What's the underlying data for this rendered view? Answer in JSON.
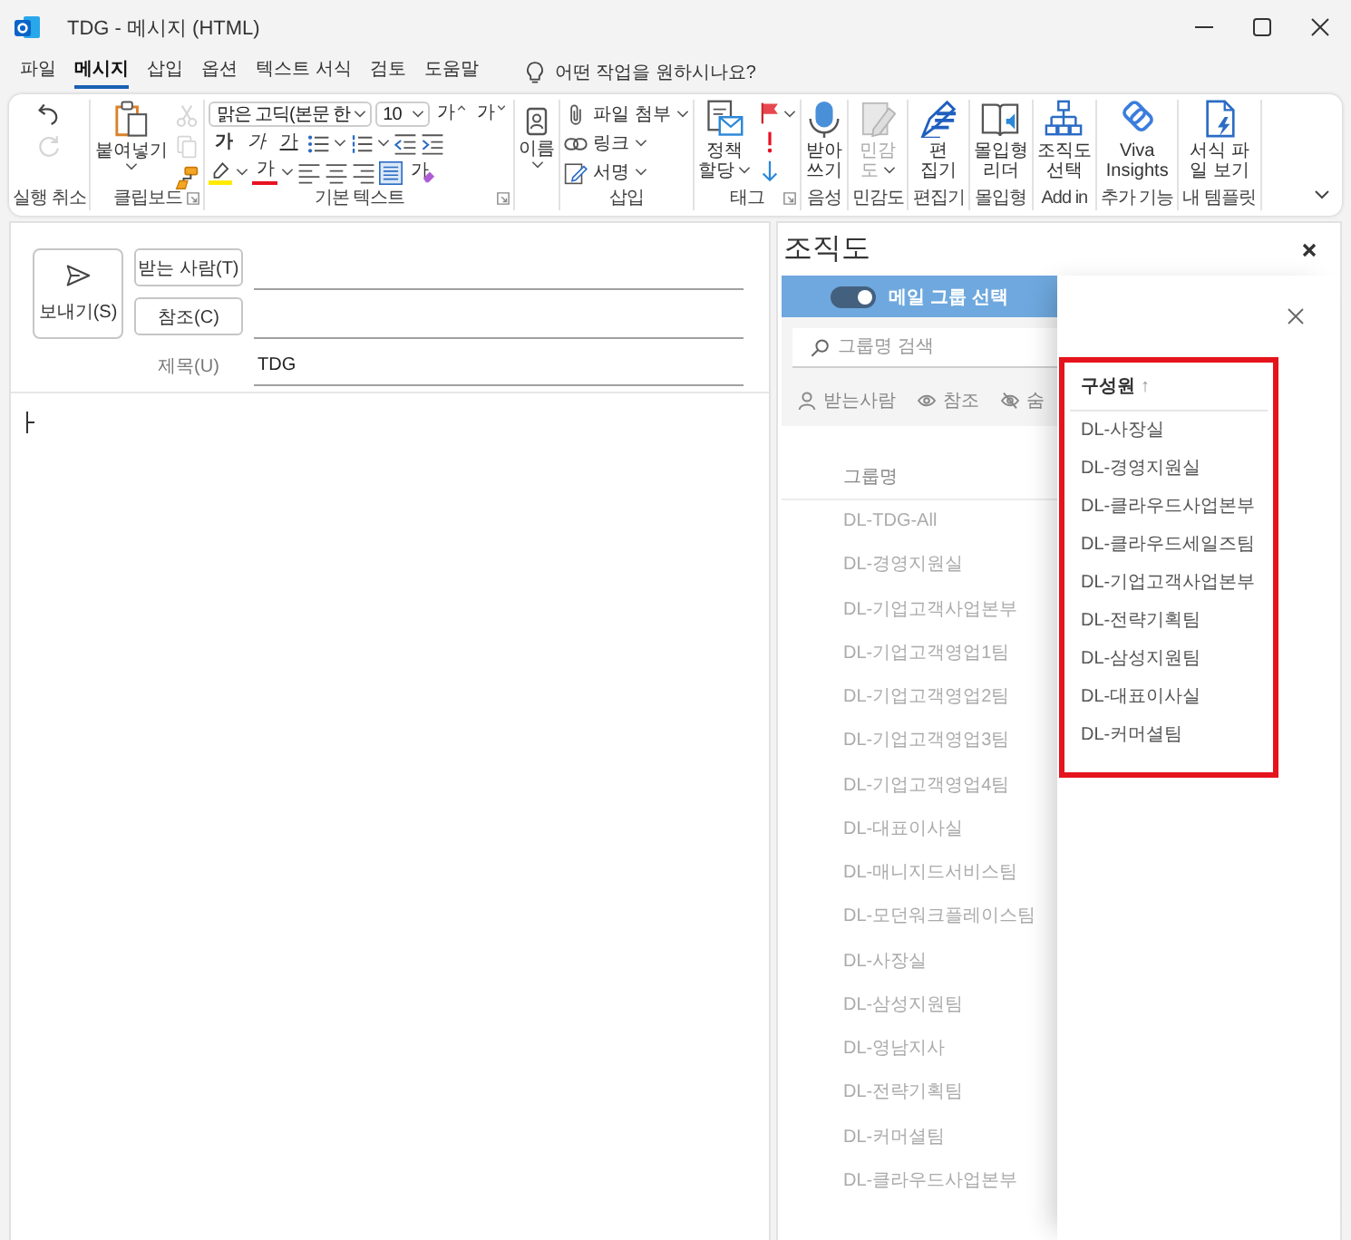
{
  "window": {
    "title": "TDG - 메시지 (HTML)"
  },
  "menu_tabs": [
    {
      "label": "파일",
      "selected": false
    },
    {
      "label": "메시지",
      "selected": true
    },
    {
      "label": "삽입",
      "selected": false
    },
    {
      "label": "옵션",
      "selected": false
    },
    {
      "label": "텍스트 서식",
      "selected": false
    },
    {
      "label": "검토",
      "selected": false
    },
    {
      "label": "도움말",
      "selected": false
    }
  ],
  "tell_me": {
    "placeholder": "어떤 작업을 원하시나요?"
  },
  "ribbon": {
    "groups": [
      {
        "kind": "undo",
        "label": "실행 취소",
        "buttons": [
          {
            "kind": "undo",
            "disabled": false
          },
          {
            "kind": "redo",
            "disabled": true
          }
        ]
      },
      {
        "kind": "clipboard",
        "label": "클립보드",
        "launcher": true,
        "paste": "붙여넣기",
        "buttons": [
          {
            "kind": "cut",
            "disabled": true
          },
          {
            "kind": "copy",
            "disabled": true
          },
          {
            "kind": "format-painter",
            "disabled": false
          }
        ]
      },
      {
        "kind": "basic-text",
        "label": "기본 텍스트",
        "launcher": true,
        "font": "맑은 고딕(본문 한",
        "size": "10",
        "grow": "가",
        "shrink": "가",
        "styles": [
          {
            "kind": "bold",
            "text": "가"
          },
          {
            "kind": "italic",
            "text": "가"
          },
          {
            "kind": "underline",
            "text": "가"
          }
        ],
        "font_color": "가",
        "clear_format": "가"
      },
      {
        "kind": "names",
        "button": "이름"
      },
      {
        "kind": "include",
        "label": "삽입",
        "items": [
          {
            "kind": "attach",
            "text": "파일 첨부"
          },
          {
            "kind": "link",
            "text": "링크"
          },
          {
            "kind": "signature",
            "text": "서명"
          }
        ]
      },
      {
        "kind": "tags",
        "label": "태그",
        "launcher": true,
        "policy": "정책\n할당"
      },
      {
        "kind": "big",
        "label": "음성",
        "button": {
          "kind": "dictate",
          "text": "받아\n쓰기",
          "disabled": false
        }
      },
      {
        "kind": "big",
        "label": "민감도",
        "button": {
          "kind": "sensitivity",
          "text": "민감\n도",
          "caret": true,
          "disabled": true
        }
      },
      {
        "kind": "big",
        "label": "편집기",
        "button": {
          "kind": "editor",
          "text": "편\n집기",
          "disabled": false
        }
      },
      {
        "kind": "big",
        "label": "몰입형",
        "button": {
          "kind": "reader",
          "text": "몰입형\n리더",
          "disabled": false
        }
      },
      {
        "kind": "big",
        "label": "Add in",
        "button": {
          "kind": "org-chart",
          "text": "조직도\n선택",
          "disabled": false
        }
      },
      {
        "kind": "big",
        "label": "추가 기능",
        "button": {
          "kind": "viva",
          "text": "Viva\nInsights",
          "disabled": false
        }
      },
      {
        "kind": "big",
        "label": "내 템플릿",
        "button": {
          "kind": "template",
          "text": "서식 파\n일 보기",
          "disabled": false
        }
      }
    ]
  },
  "compose": {
    "send": "보내기(S)",
    "to_button": "받는 사람(T)",
    "cc_button": "참조(C)",
    "subject_label": "제목(U)",
    "subject": "TDG"
  },
  "org_pane": {
    "title": "조직도",
    "group_mode": {
      "label": "메일 그룹 선택",
      "on": true
    },
    "search": {
      "placeholder": "그룹명 검색"
    },
    "recipient_types": [
      {
        "kind": "to",
        "label": "받는사람"
      },
      {
        "kind": "cc",
        "label": "참조"
      },
      {
        "kind": "bcc",
        "label": "숨"
      }
    ],
    "groups": {
      "header": "그룹명",
      "items": [
        "DL-TDG-All",
        "DL-경영지원실",
        "DL-기업고객사업본부",
        "DL-기업고객영업1팀",
        "DL-기업고객영업2팀",
        "DL-기업고객영업3팀",
        "DL-기업고객영업4팀",
        "DL-대표이사실",
        "DL-매니지드서비스팀",
        "DL-모던워크플레이스팀",
        "DL-사장실",
        "DL-삼성지원팀",
        "DL-영남지사",
        "DL-전략기획팀",
        "DL-커머셜팀",
        "DL-클라우드사업본부"
      ]
    },
    "members": {
      "header": "구성원",
      "sort": "↑",
      "highlighted": true,
      "items": [
        "DL-사장실",
        "DL-경영지원실",
        "DL-클라우드사업본부",
        "DL-클라우드세일즈팀",
        "DL-기업고객사업본부",
        "DL-전략기획팀",
        "DL-삼성지원팀",
        "DL-대표이사실",
        "DL-커머셜팀"
      ]
    }
  }
}
